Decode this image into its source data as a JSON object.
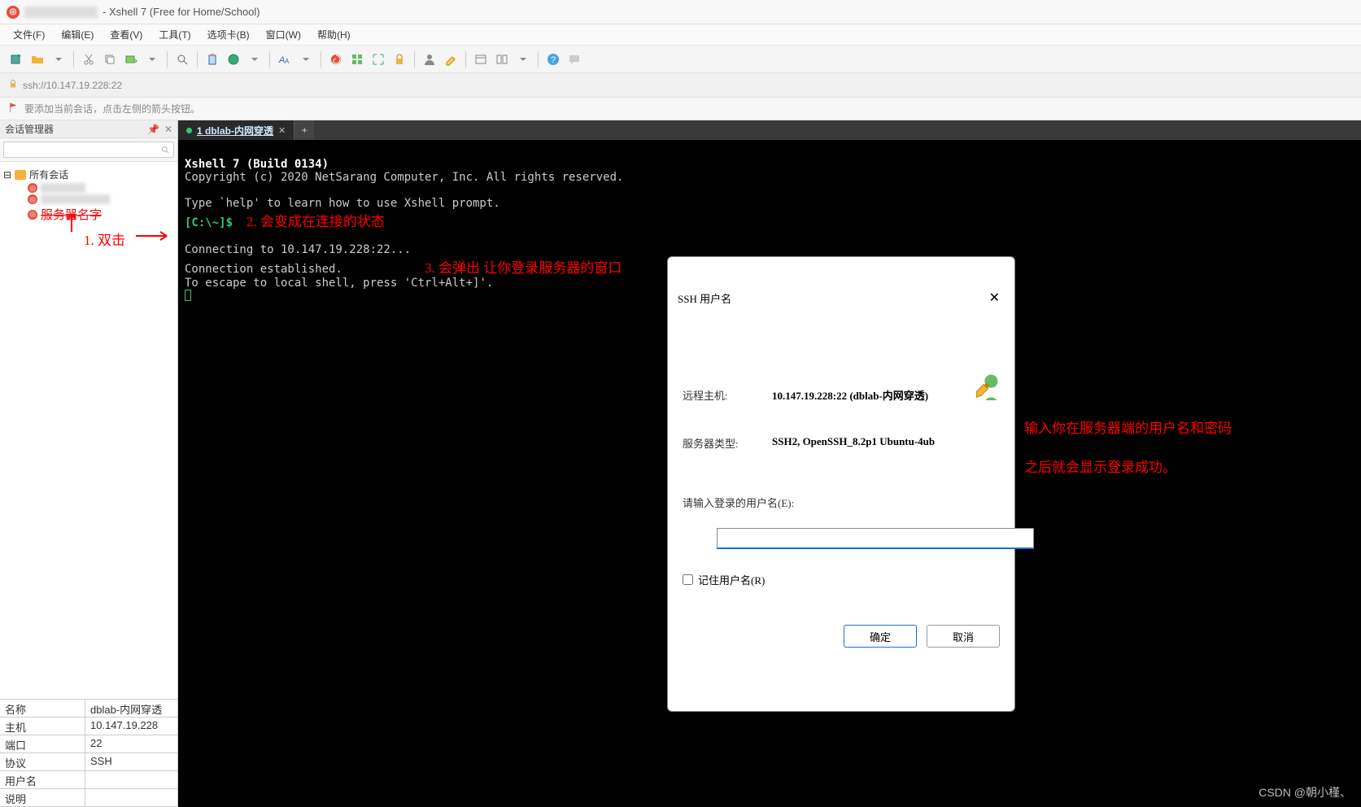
{
  "window": {
    "title": "- Xshell 7 (Free for Home/School)"
  },
  "menu": {
    "file": "文件(F)",
    "edit": "编辑(E)",
    "view": "查看(V)",
    "tools": "工具(T)",
    "tabs": "选项卡(B)",
    "window": "窗口(W)",
    "help": "帮助(H)"
  },
  "addressbar": {
    "url": "ssh://10.147.19.228:22"
  },
  "hintbar": {
    "text": "要添加当前会话，点击左侧的箭头按钮。"
  },
  "sidebar": {
    "title": "会话管理器",
    "root": "所有会话",
    "item3": "服务器名字"
  },
  "properties": {
    "rows": [
      {
        "k": "名称",
        "v": "dblab-内网穿透"
      },
      {
        "k": "主机",
        "v": "10.147.19.228"
      },
      {
        "k": "端口",
        "v": "22"
      },
      {
        "k": "协议",
        "v": "SSH"
      },
      {
        "k": "用户名",
        "v": ""
      },
      {
        "k": "说明",
        "v": ""
      }
    ]
  },
  "tab": {
    "label": "1 dblab-内网穿透",
    "add": "+"
  },
  "terminal": {
    "l1": "Xshell 7 (Build 0134)",
    "l2": "Copyright (c) 2020 NetSarang Computer, Inc. All rights reserved.",
    "l3": "",
    "l4": "Type `help' to learn how to use Xshell prompt.",
    "l5": "[C:\\~]$",
    "l6": "",
    "l7": "Connecting to 10.147.19.228:22...",
    "l8": "Connection established.",
    "l9": "To escape to local shell, press 'Ctrl+Alt+]'."
  },
  "dialog": {
    "title": "SSH 用户名",
    "host_lbl": "远程主机:",
    "host_val": "10.147.19.228:22 (dblab-内网穿透)",
    "type_lbl": "服务器类型:",
    "type_val": "SSH2, OpenSSH_8.2p1 Ubuntu-4ub",
    "field_lbl": "请输入登录的用户名(E):",
    "remember": "记住用户名(R)",
    "ok": "确定",
    "cancel": "取消"
  },
  "annotations": {
    "a1": "1. 双击",
    "a2": "2. 会变成在连接的状态",
    "a3": "3. 会弹出 让你登录服务器的窗口",
    "a4": "输入你在服务器端的用户名和密码",
    "a5": "之后就会显示登录成功。"
  },
  "watermark": "CSDN @朝小槿、"
}
